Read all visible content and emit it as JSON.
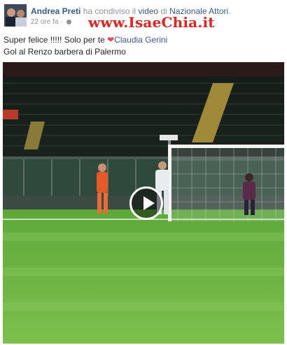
{
  "post": {
    "author": "Andrea Preti",
    "action_prefix": "ha condiviso il",
    "shared_type": "video",
    "connector": "di",
    "page_name": "Nazionale Attori",
    "page_suffix": ".",
    "time": "22 ore fa",
    "dot": "·",
    "privacy_icon": "globe-icon",
    "text_line1": "Super felice !!!!! Solo per te",
    "heart_glyph": "❤",
    "tagged_person": "Claudia Gerini",
    "text_line2": "Gol al Renzo barbera di Palermo"
  },
  "watermark": "www.IsaeChia.it",
  "video": {
    "play_icon": "play-icon"
  },
  "colors": {
    "link": "#365899",
    "watermark": "#e2231f",
    "heart": "#f0435a"
  }
}
